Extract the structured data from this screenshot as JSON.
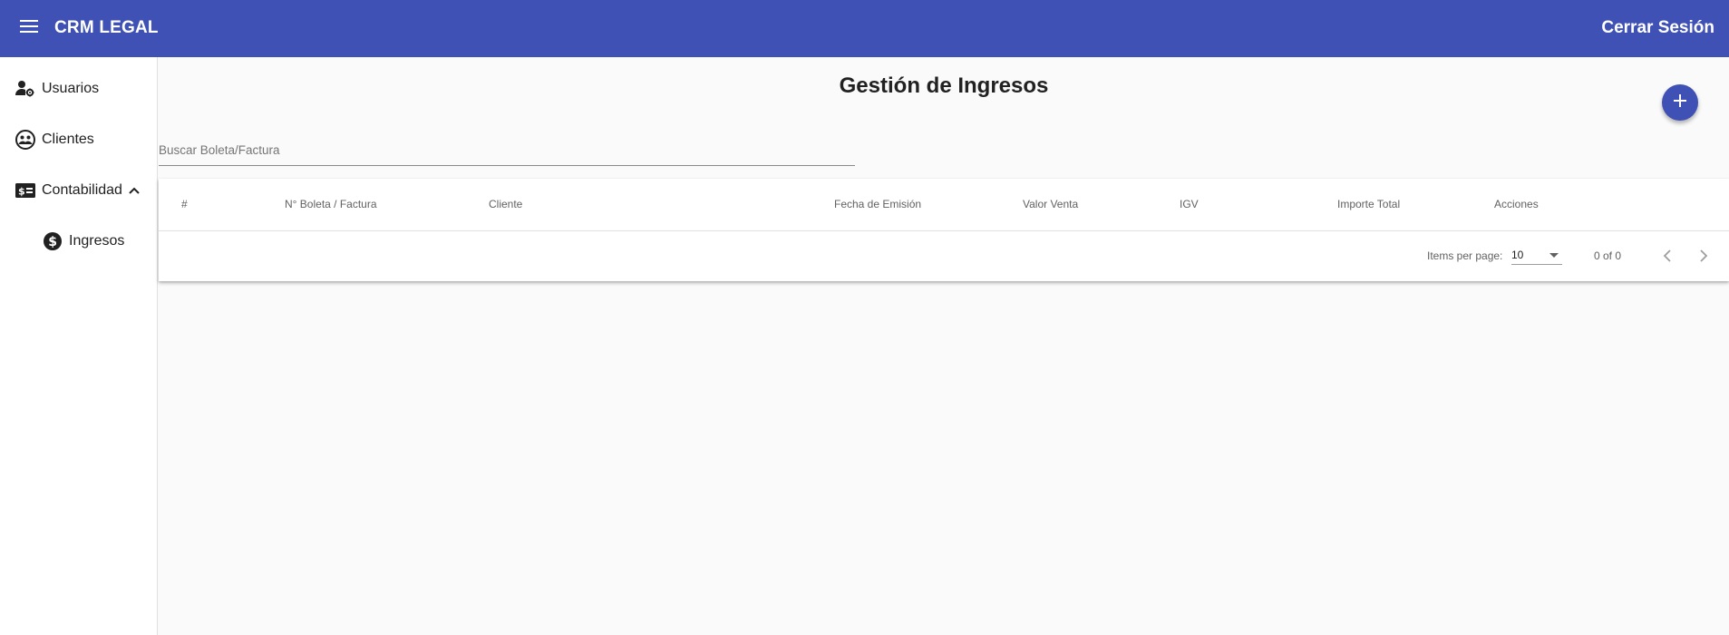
{
  "header": {
    "menu_icon": "menu-icon",
    "brand": "CRM LEGAL",
    "logout_label": "Cerrar Sesión",
    "color": "#3f51b5"
  },
  "sidebar": {
    "items": [
      {
        "label": "Usuarios",
        "icon": "user-gear-icon"
      },
      {
        "label": "Clientes",
        "icon": "clients-icon"
      },
      {
        "label": "Contabilidad",
        "icon": "accounting-icon",
        "expanded": true,
        "chevron": "chevron-up-icon"
      },
      {
        "label": "Ingresos",
        "icon": "dollar-icon",
        "sub": true
      }
    ]
  },
  "main": {
    "title": "Gestión de Ingresos",
    "add_button_icon": "plus-icon",
    "search": {
      "placeholder": "Buscar Boleta/Factura",
      "value": ""
    },
    "table": {
      "columns": [
        "#",
        "N° Boleta / Factura",
        "Cliente",
        "Fecha de Emisión",
        "Valor Venta",
        "IGV",
        "Importe Total",
        "Acciones"
      ],
      "rows": []
    },
    "paginator": {
      "items_per_page_label": "Items per page:",
      "items_per_page_value": "10",
      "range_label": "0 of 0",
      "prev_icon": "chevron-left-icon",
      "next_icon": "chevron-right-icon"
    }
  }
}
